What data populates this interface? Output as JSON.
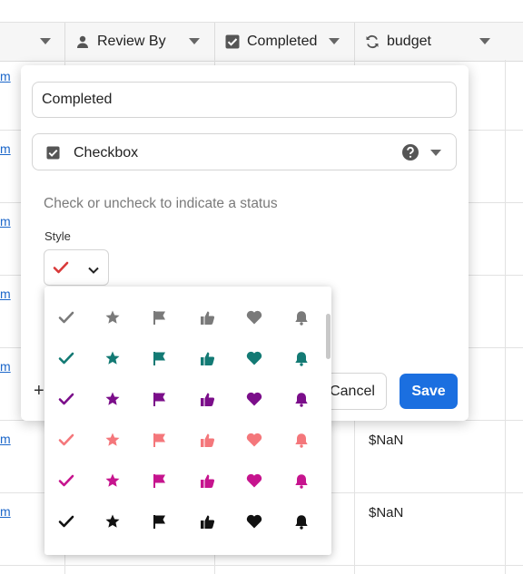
{
  "header": {
    "columns": [
      {
        "label": "",
        "icon": "chevron-down-icon"
      },
      {
        "label": "Review By",
        "icon": "person-icon"
      },
      {
        "label": "Completed",
        "icon": "checkbox-icon"
      },
      {
        "label": "budget",
        "icon": "formula-icon"
      }
    ]
  },
  "rows": {
    "link_text": "m",
    "budget_values": [
      "$NaN",
      "$NaN"
    ]
  },
  "editor": {
    "field_name": "Completed",
    "field_type": "Checkbox",
    "description": "Check or uncheck to indicate a status",
    "style_label": "Style",
    "selected_style": {
      "icon": "check-icon",
      "color": "#d93a3a"
    },
    "add_label": "+",
    "cancel_label": "Cancel",
    "save_label": "Save"
  },
  "style_dropdown": {
    "icons": [
      "check-icon",
      "star-icon",
      "flag-icon",
      "thumbs-up-icon",
      "heart-icon",
      "bell-icon"
    ],
    "colors": [
      "#7a7a7a",
      "#137a74",
      "#7b0e8a",
      "#f4777b",
      "#c6148e",
      "#111111"
    ]
  },
  "colors": {
    "save_button": "#1b6fe0",
    "link": "#1b66c9"
  }
}
